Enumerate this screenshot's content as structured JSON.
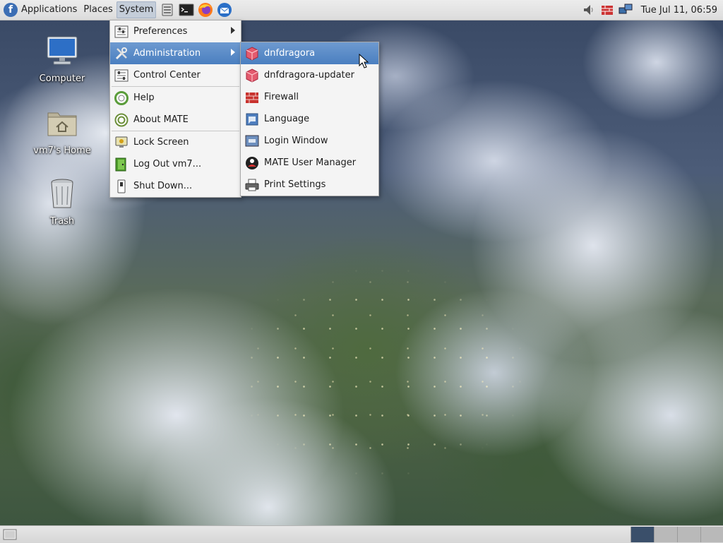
{
  "top_panel": {
    "menus": [
      "Applications",
      "Places",
      "System"
    ],
    "clock": "Tue Jul 11, 06:59"
  },
  "desktop": {
    "icons": [
      {
        "label": "Computer",
        "icon": "computer-icon"
      },
      {
        "label": "vm7's Home",
        "icon": "home-folder-icon"
      },
      {
        "label": "Trash",
        "icon": "trash-icon"
      }
    ]
  },
  "system_menu": {
    "items": [
      {
        "label": "Preferences",
        "icon": "preferences-icon",
        "submenu": true
      },
      {
        "label": "Administration",
        "icon": "administration-icon",
        "submenu": true,
        "highlighted": true
      },
      {
        "label": "Control Center",
        "icon": "control-center-icon"
      },
      {
        "label": "Help",
        "icon": "help-icon"
      },
      {
        "label": "About MATE",
        "icon": "about-mate-icon"
      },
      {
        "label": "Lock Screen",
        "icon": "lock-screen-icon"
      },
      {
        "label": "Log Out vm7...",
        "icon": "logout-icon"
      },
      {
        "label": "Shut Down...",
        "icon": "shutdown-icon"
      }
    ]
  },
  "admin_menu": {
    "items": [
      {
        "label": "dnfdragora",
        "icon": "package-icon",
        "highlighted": true
      },
      {
        "label": "dnfdragora-updater",
        "icon": "package-updater-icon"
      },
      {
        "label": "Firewall",
        "icon": "firewall-icon"
      },
      {
        "label": "Language",
        "icon": "language-icon"
      },
      {
        "label": "Login Window",
        "icon": "login-window-icon"
      },
      {
        "label": "MATE User Manager",
        "icon": "user-manager-icon"
      },
      {
        "label": "Print Settings",
        "icon": "printer-icon"
      }
    ]
  },
  "colors": {
    "highlight": "#4a7fc0",
    "panel": "#dcdcdc"
  }
}
